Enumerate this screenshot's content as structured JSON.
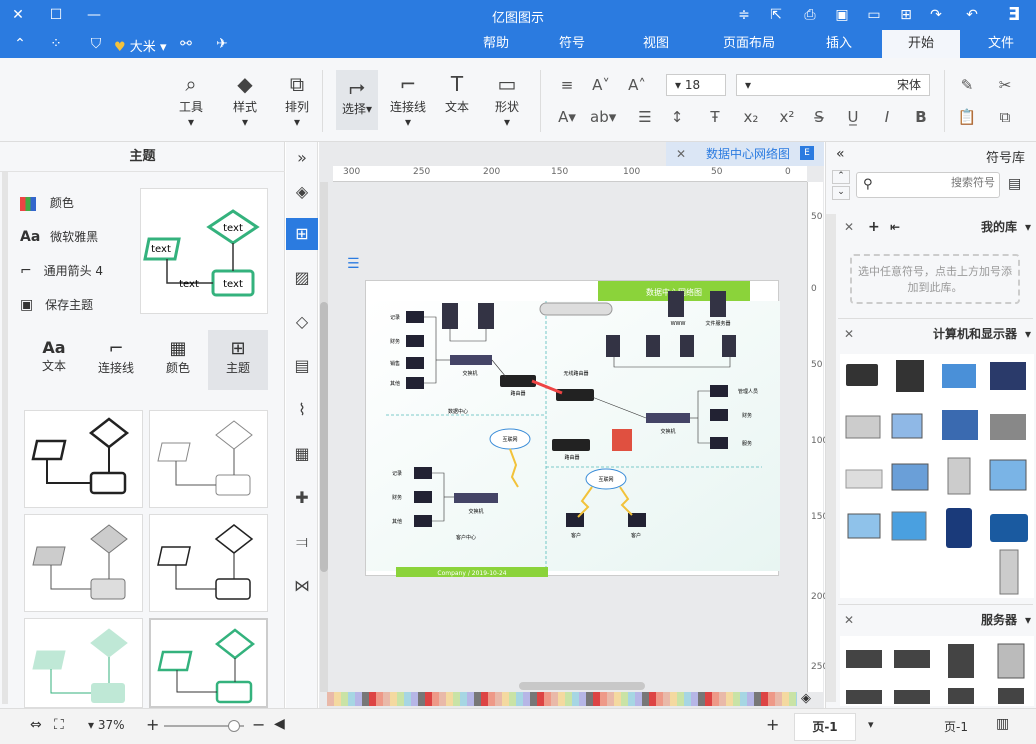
{
  "title_bar": {
    "app_title": "亿图图示"
  },
  "menu": {
    "tabs": [
      {
        "label": "文件"
      },
      {
        "label": "开始"
      },
      {
        "label": "插入"
      },
      {
        "label": "页面布局"
      },
      {
        "label": "视图"
      },
      {
        "label": "符号"
      },
      {
        "label": "帮助"
      }
    ],
    "active": "开始",
    "user_name": "大米"
  },
  "ribbon": {
    "font_name": "宋体",
    "font_size": "18",
    "tools": [
      {
        "label": "形状"
      },
      {
        "label": "文本"
      },
      {
        "label": "连接线"
      },
      {
        "label": "选择"
      },
      {
        "label": "排列"
      },
      {
        "label": "样式"
      },
      {
        "label": "工具"
      }
    ]
  },
  "left_panel": {
    "title": "主题",
    "options": [
      {
        "label": "颜色"
      },
      {
        "label": "微软雅黑"
      },
      {
        "label": "通用箭头 4"
      },
      {
        "label": "保存主题"
      }
    ],
    "sample_texts": [
      "text",
      "text",
      "text",
      "text"
    ],
    "tabs": [
      {
        "label": "主题"
      },
      {
        "label": "颜色"
      },
      {
        "label": "连接线"
      },
      {
        "label": "文本"
      }
    ]
  },
  "document": {
    "tab_title": "数据中心网络图"
  },
  "canvas": {
    "ruler_top": [
      "0",
      "50",
      "100",
      "150",
      "200",
      "250",
      "300"
    ],
    "ruler_left": [
      "50",
      "0",
      "50",
      "100",
      "150",
      "200",
      "250"
    ],
    "diagram_title": "数据中心网络图",
    "diagram_footer": "Company / 2019-10-24",
    "left_labels": [
      "记录",
      "财务",
      "销售",
      "其他"
    ],
    "right_labels": [
      "管理人员",
      "财务",
      "服务"
    ],
    "bottom_left_labels": [
      "记录",
      "财务",
      "其他"
    ],
    "hub_labels": [
      "交换机",
      "交换机",
      "交换机"
    ],
    "router_labels": [
      "路由器",
      "无线路由器",
      "路由器"
    ],
    "cloud_label": "互联网",
    "server_labels": [
      "WWW",
      "文件服务器"
    ],
    "division_left": "数据中心",
    "division_bottom": "客户中心",
    "client_labels": [
      "客户",
      "客户"
    ]
  },
  "right_panel": {
    "title": "符号库",
    "search_placeholder": "搜索符号",
    "my_library": "我的库",
    "my_library_hint": "选中任意符号，点击上方加号添加到此库。",
    "section1": "计算机和显示器",
    "section2": "服务器"
  },
  "status": {
    "page_label": "页-1",
    "page_tab": "页-1",
    "add_page": "+",
    "zoom": "37%"
  },
  "colors": {
    "accent": "#2b7be0",
    "theme_green": "#34b27d",
    "diagram_green": "#8bd33a"
  }
}
